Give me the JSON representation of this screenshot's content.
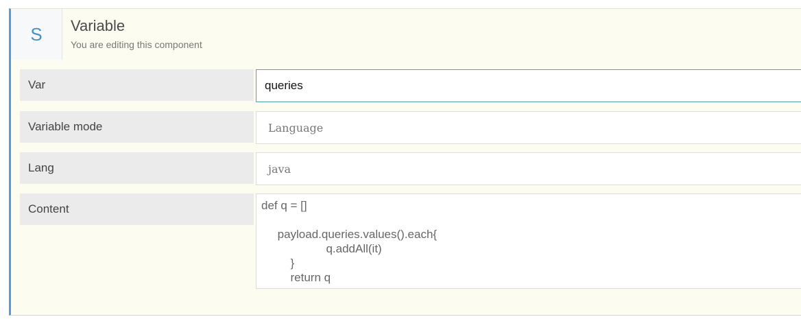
{
  "header": {
    "avatar_letter": "S",
    "title": "Variable",
    "subtitle": "You are editing this component"
  },
  "form": {
    "var": {
      "label": "Var",
      "value": "queries"
    },
    "variable_mode": {
      "label": "Variable mode",
      "value": "Language"
    },
    "lang": {
      "label": "Lang",
      "value": "java"
    },
    "content": {
      "label": "Content",
      "value": "def q = []\n\n     payload.queries.values().each{\n                    q.addAll(it)\n         }\n         return q"
    }
  },
  "colors": {
    "accent": "#5b9bd5",
    "panel_bg": "#fcfcf1",
    "label_bg": "#ebebeb",
    "focus_border": "#4aa9a0"
  }
}
